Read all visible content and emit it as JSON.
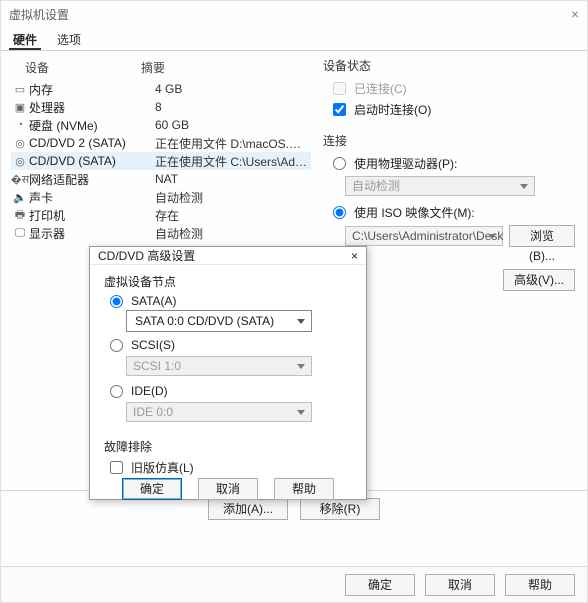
{
  "window": {
    "title": "虚拟机设置",
    "close_glyph": "×"
  },
  "tabs": {
    "hardware": "硬件",
    "options": "选项"
  },
  "hw_headers": {
    "device": "设备",
    "summary": "摘要"
  },
  "hw": [
    {
      "icon": "memory",
      "dev": "内存",
      "sum": "4 GB"
    },
    {
      "icon": "cpu",
      "dev": "处理器",
      "sum": "8"
    },
    {
      "icon": "disk",
      "dev": "硬盘 (NVMe)",
      "sum": "60 GB"
    },
    {
      "icon": "disc",
      "dev": "CD/DVD 2 (SATA)",
      "sum": "正在使用文件 D:\\macOS.Mont..."
    },
    {
      "icon": "disc",
      "dev": "CD/DVD (SATA)",
      "sum": "正在使用文件 C:\\Users\\Adminis...",
      "selected": true
    },
    {
      "icon": "net",
      "dev": "网络适配器",
      "sum": "NAT"
    },
    {
      "icon": "sound",
      "dev": "声卡",
      "sum": "自动检测"
    },
    {
      "icon": "printer",
      "dev": "打印机",
      "sum": "存在"
    },
    {
      "icon": "display",
      "dev": "显示器",
      "sum": "自动检测"
    }
  ],
  "status": {
    "heading": "设备状态",
    "connected": "已连接(C)",
    "on_power": "启动时连接(O)"
  },
  "connection": {
    "heading": "连接",
    "use_physical": "使用物理驱动器(P):",
    "physical_value": "自动检测",
    "use_iso": "使用 ISO 映像文件(M):",
    "iso_value": "C:\\Users\\Administrator\\Desk",
    "browse": "浏览(B)...",
    "advanced": "高级(V)..."
  },
  "bottom": {
    "add": "添加(A)...",
    "remove": "移除(R)"
  },
  "footer": {
    "ok": "确定",
    "cancel": "取消",
    "help": "帮助"
  },
  "modal": {
    "title": "CD/DVD 高级设置",
    "close_glyph": "×",
    "node_group": "虚拟设备节点",
    "sata_label": "SATA(A)",
    "sata_value": "SATA 0:0   CD/DVD (SATA)",
    "scsi_label": "SCSI(S)",
    "scsi_value": "SCSI 1:0",
    "ide_label": "IDE(D)",
    "ide_value": "IDE 0:0",
    "trouble_group": "故障排除",
    "legacy": "旧版仿真(L)",
    "ok": "确定",
    "cancel": "取消",
    "help": "帮助"
  }
}
